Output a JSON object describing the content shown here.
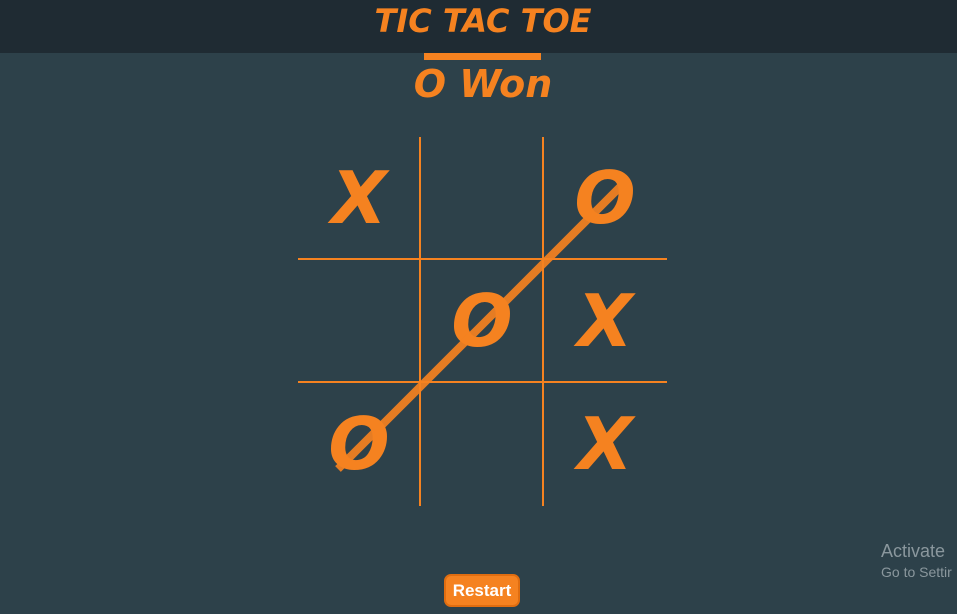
{
  "header": {
    "title": "TIC TAC TOE"
  },
  "status": {
    "text": "O Won"
  },
  "board": {
    "cells": [
      "X",
      "",
      "O",
      "",
      "O",
      "X",
      "O",
      "",
      "X"
    ],
    "winning_cells": [
      2,
      4,
      6
    ]
  },
  "controls": {
    "restart_label": "Restart"
  },
  "watermark": {
    "title": "Activate",
    "subtitle": "Go to Settir"
  },
  "colors": {
    "accent": "#f58220",
    "background": "#2d414a",
    "header_background": "#1f2b33"
  }
}
